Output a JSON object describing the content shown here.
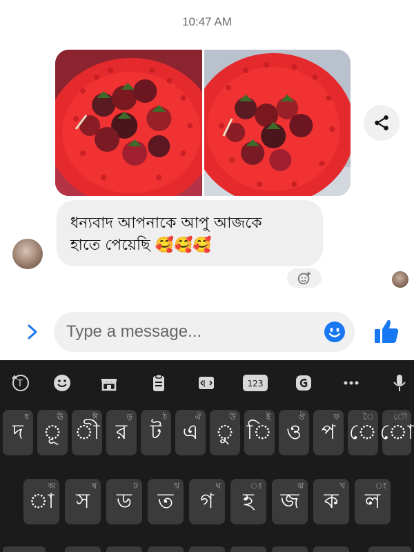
{
  "chat": {
    "timestamp": "10:47 AM",
    "message_line1": "ধন্যবাদ আপনাকে আপু আজকে",
    "message_line2": "হাতে পেয়েছি 🥰🥰🥰"
  },
  "composer": {
    "placeholder": "Type a message..."
  },
  "icons": {
    "share": "share-icon",
    "react": "add-reaction-icon",
    "expand": "chevron-right-icon",
    "emoji": "smiley-icon",
    "like": "thumbs-up-icon"
  },
  "keyboard": {
    "toolbar": [
      "translate-icon",
      "emoji-icon",
      "sticker-icon",
      "clipboard-icon",
      "text-edit-icon",
      "123",
      "gif-icon",
      "more-icon",
      "mic-icon"
    ],
    "row1": [
      {
        "label": "দ",
        "hint": "ধ"
      },
      {
        "label": "ূ",
        "hint": "ঊ"
      },
      {
        "label": "ী",
        "hint": "ঈ"
      },
      {
        "label": "র",
        "hint": "ড়"
      },
      {
        "label": "ট",
        "hint": "ঠ"
      },
      {
        "label": "এ",
        "hint": "ঐ"
      },
      {
        "label": "ু",
        "hint": "উ"
      },
      {
        "label": "ি",
        "hint": "ই"
      },
      {
        "label": "ও",
        "hint": "ঔ"
      },
      {
        "label": "প",
        "hint": "ফ"
      },
      {
        "label": "ে",
        "hint": "ৈ"
      },
      {
        "label": "ো",
        "hint": "ৌ"
      }
    ],
    "row2": [
      {
        "label": "া",
        "hint": "অ"
      },
      {
        "label": "স",
        "hint": "ষ"
      },
      {
        "label": "ড",
        "hint": "ঢ"
      },
      {
        "label": "ত",
        "hint": "থ"
      },
      {
        "label": "গ",
        "hint": "ঘ"
      },
      {
        "label": "হ",
        "hint": "ঃ"
      },
      {
        "label": "জ",
        "hint": "ঝ"
      },
      {
        "label": "ক",
        "hint": "খ"
      },
      {
        "label": "ল",
        "hint": "ং"
      }
    ]
  },
  "colors": {
    "accent": "#1877f2",
    "basket": "#e8262c",
    "keyboard_bg": "#1b1b1b",
    "key_bg": "#3b3b3b"
  }
}
